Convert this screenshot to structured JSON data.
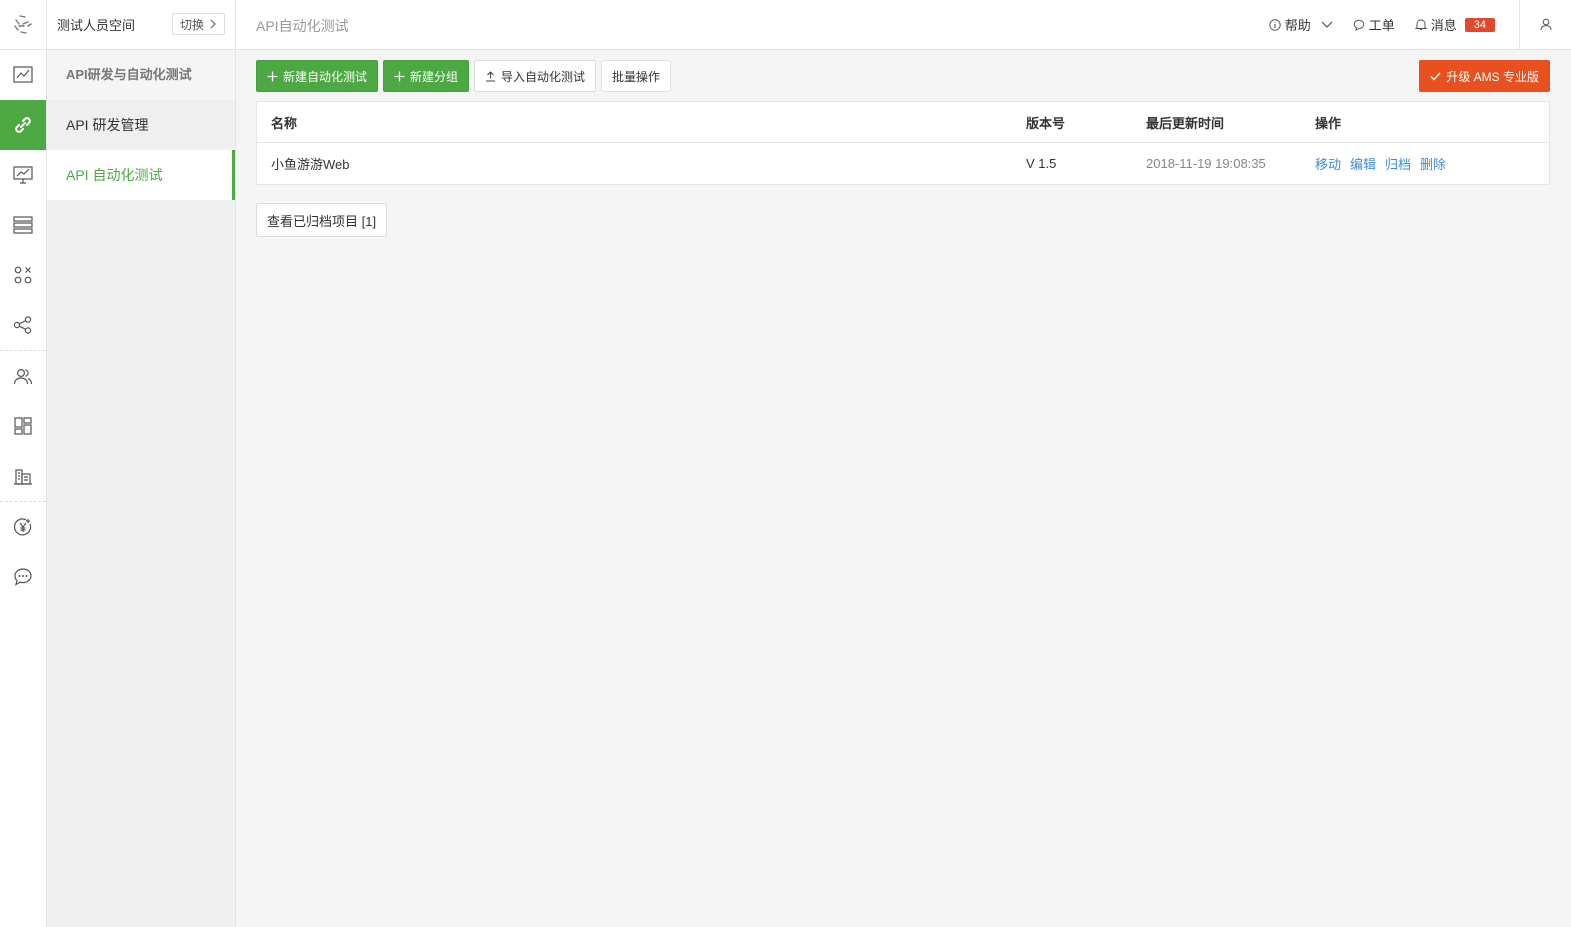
{
  "header": {
    "workspace_name": "测试人员空间",
    "switch_label": "切换",
    "page_title": "API自动化测试",
    "help_label": "帮助",
    "ticket_label": "工单",
    "messages_label": "消息",
    "messages_count": "34"
  },
  "rail": {
    "icons": [
      "dashboard-icon",
      "api-link-icon",
      "monitor-icon",
      "server-icon",
      "apps-icon",
      "share-icon",
      "team-icon",
      "layout-icon",
      "building-icon",
      "billing-icon",
      "chat-icon"
    ]
  },
  "subnav": {
    "title": "API研发与自动化测试",
    "items": [
      {
        "label": "API 研发管理"
      },
      {
        "label": "API 自动化测试"
      }
    ]
  },
  "toolbar": {
    "new_test": "新建自动化测试",
    "new_group": "新建分组",
    "import_test": "导入自动化测试",
    "batch": "批量操作",
    "upgrade": "升级 AMS 专业版"
  },
  "table": {
    "headers": [
      "名称",
      "版本号",
      "最后更新时间",
      "操作"
    ],
    "rows": [
      {
        "name": "小鱼游游Web",
        "version": "V 1.5",
        "updated": "2018-11-19 19:08:35",
        "actions": [
          "移动",
          "编辑",
          "归档",
          "删除"
        ]
      }
    ]
  },
  "archive_button": "查看已归档项目 [1]",
  "colors": {
    "accent_green": "#4ca843",
    "upgrade_orange": "#e8501f",
    "link_blue": "#3d8dd4",
    "badge_red": "#e04a2a"
  }
}
